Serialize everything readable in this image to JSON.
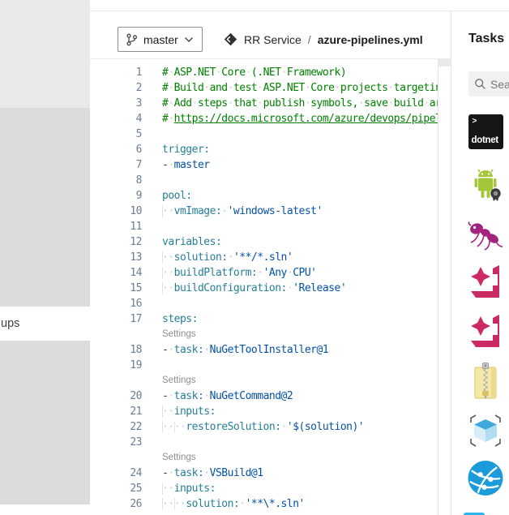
{
  "colors": {
    "comment": "#008000",
    "yaml_key": "#267f99",
    "yaml_value": "#0451a5",
    "panel_divider": "#e6e6e6",
    "app_center_crimson": "#cb2a63",
    "android_green": "#a4c639",
    "globe_blue": "#1b9bd9"
  },
  "left_nav": {
    "partial_item_label": "ups"
  },
  "header": {
    "branch": {
      "label": "master"
    },
    "breadcrumb": {
      "repo_name": "RR Service",
      "separator": "/",
      "file_name": "azure-pipelines.yml"
    }
  },
  "tasks_panel": {
    "title": "Tasks",
    "search_placeholder": "Search",
    "dotnet_icon_text_top": ">",
    "dotnet_icon_text": "dotnet",
    "task_icons": [
      "dotnet-core",
      "android-signing",
      "ant",
      "app-center-distribute",
      "app-center-test",
      "archive-files",
      "arm-template-deployment",
      "azure-app-service-deploy"
    ]
  },
  "editor": {
    "settings_label": "Settings",
    "lines": [
      {
        "n": "1",
        "t": [
          [
            "c",
            "#·ASP.NET·Core·(.NET·Framework)"
          ]
        ]
      },
      {
        "n": "2",
        "t": [
          [
            "c",
            "#·Build·and·test·ASP.NET·Core·projects·targeting"
          ]
        ]
      },
      {
        "n": "3",
        "t": [
          [
            "c",
            "#·Add·steps·that·publish·symbols,·save·build·artifacts,"
          ]
        ]
      },
      {
        "n": "4",
        "t": [
          [
            "c",
            "#·"
          ],
          [
            "l",
            "https://docs.microsoft.com/azure/devops/pipelines"
          ]
        ]
      },
      {
        "n": "5",
        "t": []
      },
      {
        "n": "6",
        "t": [
          [
            "k",
            "trigger:"
          ]
        ]
      },
      {
        "n": "7",
        "t": [
          [
            "p",
            "-"
          ],
          [
            "w",
            "·"
          ],
          [
            "v",
            "master"
          ]
        ]
      },
      {
        "n": "8",
        "t": []
      },
      {
        "n": "9",
        "t": [
          [
            "k",
            "pool:"
          ]
        ]
      },
      {
        "n": "10",
        "t": [
          [
            "g",
            "··"
          ],
          [
            "k",
            "vmImage:"
          ],
          [
            "w",
            "·"
          ],
          [
            "v",
            "'windows-latest'"
          ]
        ]
      },
      {
        "n": "11",
        "t": []
      },
      {
        "n": "12",
        "t": [
          [
            "k",
            "variables:"
          ]
        ]
      },
      {
        "n": "13",
        "t": [
          [
            "g",
            "··"
          ],
          [
            "k",
            "solution:"
          ],
          [
            "w",
            "·"
          ],
          [
            "v",
            "'**/*.sln'"
          ]
        ]
      },
      {
        "n": "14",
        "t": [
          [
            "g",
            "··"
          ],
          [
            "k",
            "buildPlatform:"
          ],
          [
            "w",
            "·"
          ],
          [
            "v",
            "'Any·CPU'"
          ]
        ]
      },
      {
        "n": "15",
        "t": [
          [
            "g",
            "··"
          ],
          [
            "k",
            "buildConfiguration:"
          ],
          [
            "w",
            "·"
          ],
          [
            "v",
            "'Release'"
          ]
        ]
      },
      {
        "n": "16",
        "t": []
      },
      {
        "n": "17",
        "t": [
          [
            "k",
            "steps:"
          ]
        ]
      },
      {
        "settings": "Settings"
      },
      {
        "n": "18",
        "t": [
          [
            "p",
            "-"
          ],
          [
            "w",
            "·"
          ],
          [
            "k",
            "task:"
          ],
          [
            "w",
            "·"
          ],
          [
            "v",
            "NuGetToolInstaller@1"
          ]
        ]
      },
      {
        "n": "19",
        "t": []
      },
      {
        "settings": "Settings"
      },
      {
        "n": "20",
        "t": [
          [
            "p",
            "-"
          ],
          [
            "w",
            "·"
          ],
          [
            "k",
            "task:"
          ],
          [
            "w",
            "·"
          ],
          [
            "v",
            "NuGetCommand@2"
          ]
        ]
      },
      {
        "n": "21",
        "t": [
          [
            "g",
            "··"
          ],
          [
            "k",
            "inputs:"
          ]
        ]
      },
      {
        "n": "22",
        "t": [
          [
            "g",
            "··"
          ],
          [
            "g",
            "··"
          ],
          [
            "k",
            "restoreSolution:"
          ],
          [
            "w",
            "·"
          ],
          [
            "v",
            "'$(solution)'"
          ]
        ]
      },
      {
        "n": "23",
        "t": []
      },
      {
        "settings": "Settings"
      },
      {
        "n": "24",
        "t": [
          [
            "p",
            "-"
          ],
          [
            "w",
            "·"
          ],
          [
            "k",
            "task:"
          ],
          [
            "w",
            "·"
          ],
          [
            "v",
            "VSBuild@1"
          ]
        ]
      },
      {
        "n": "25",
        "t": [
          [
            "g",
            "··"
          ],
          [
            "k",
            "inputs:"
          ]
        ]
      },
      {
        "n": "26",
        "t": [
          [
            "g",
            "··"
          ],
          [
            "g",
            "··"
          ],
          [
            "k",
            "solution:"
          ],
          [
            "w",
            "·"
          ],
          [
            "v",
            "'**\\*.sln'"
          ]
        ]
      }
    ]
  }
}
